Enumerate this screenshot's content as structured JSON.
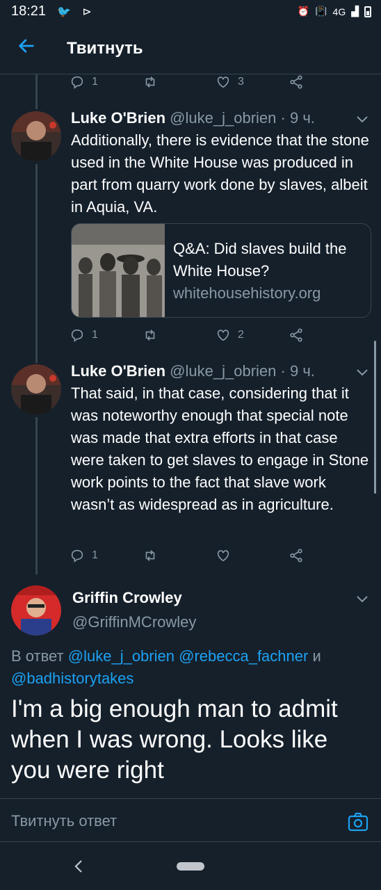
{
  "status_bar": {
    "time": "18:21",
    "icons_left": "🐦 ⊳",
    "network": "4G"
  },
  "app_bar": {
    "title": "Твитнуть"
  },
  "top_actions": {
    "reply_count": "1",
    "retweet_count": "",
    "like_count": "3"
  },
  "tweets": [
    {
      "name": "Luke O'Brien",
      "handle": "@luke_j_obrien",
      "dot": "·",
      "time": "9 ч.",
      "text": "Additionally, there is evidence that the stone used in the White House was produced in part from quarry work done by slaves, albeit in Aquia, VA.",
      "card": {
        "title": "Q&A: Did slaves build the White House?",
        "domain": "whitehousehistory.org"
      },
      "reply_count": "1",
      "like_count": "2"
    },
    {
      "name": "Luke O'Brien",
      "handle": "@luke_j_obrien",
      "dot": "·",
      "time": "9 ч.",
      "text": "That said, in that case, considering that it was noteworthy enough that special note was made that extra efforts in that case were taken to get slaves to engage in Stone work points to the fact that slave work wasn’t as widespread as in agriculture.",
      "reply_count": "1",
      "like_count": ""
    }
  ],
  "main_tweet": {
    "name": "Griffin Crowley",
    "handle": "@GriffinMCrowley",
    "reply_prefix": "В ответ",
    "mention1": "@luke_j_obrien",
    "mention2": "@rebecca_fachner",
    "conj": "и",
    "mention3": "@badhistorytakes",
    "text": "I'm a big enough man to admit when I was wrong. Looks like you were right"
  },
  "compose": {
    "placeholder": "Твитнуть ответ"
  },
  "colors": {
    "background": "#15202b",
    "accent": "#1da1f2",
    "secondary_text": "#8899a6",
    "border": "#38444d"
  }
}
